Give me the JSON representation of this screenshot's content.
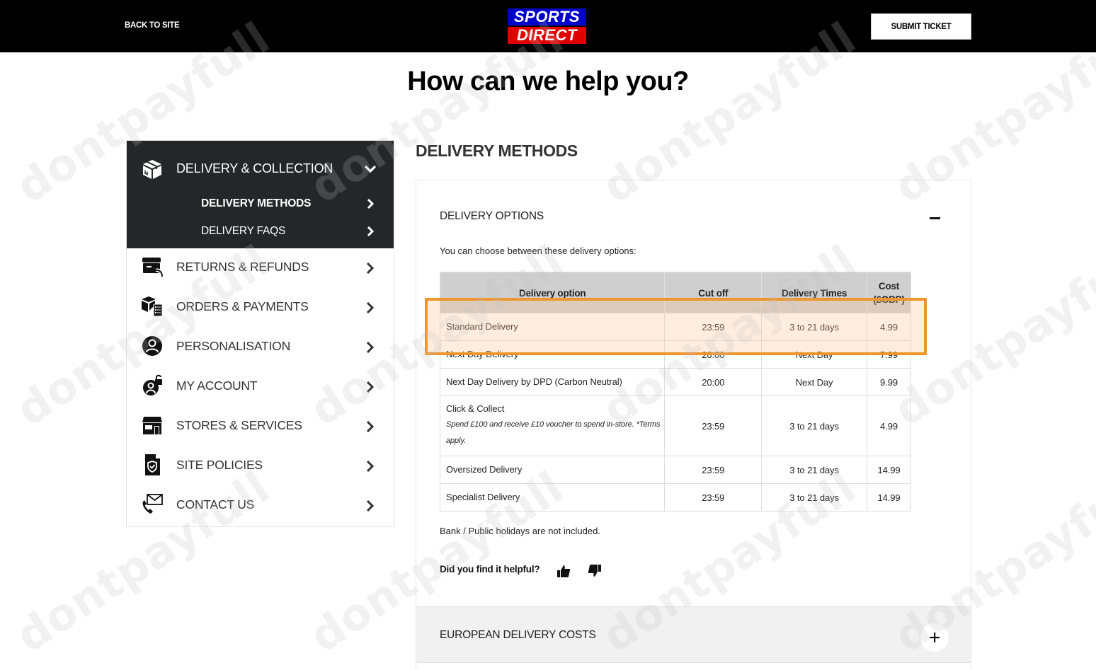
{
  "header": {
    "back_label": "BACK TO SITE",
    "logo_line1": "SPORTS",
    "logo_line2": "DIRECT",
    "submit_label": "SUBMIT TICKET",
    "brand_colors": {
      "blue": "#0000cc",
      "red": "#e00000"
    }
  },
  "page_title": "How can we help you?",
  "sidebar": {
    "active_section": {
      "label": "DELIVERY & COLLECTION",
      "icon": "box-icon",
      "subitems": [
        {
          "label": "DELIVERY METHODS",
          "selected": true
        },
        {
          "label": "DELIVERY FAQS",
          "selected": false
        }
      ]
    },
    "items": [
      {
        "label": "RETURNS & REFUNDS",
        "icon": "return-box-icon"
      },
      {
        "label": "ORDERS & PAYMENTS",
        "icon": "orders-icon"
      },
      {
        "label": "PERSONALISATION",
        "icon": "user-circle-icon"
      },
      {
        "label": "MY ACCOUNT",
        "icon": "account-lock-icon"
      },
      {
        "label": "STORES & SERVICES",
        "icon": "store-icon"
      },
      {
        "label": "SITE POLICIES",
        "icon": "policy-shield-icon"
      },
      {
        "label": "CONTACT US",
        "icon": "contact-icon"
      }
    ]
  },
  "main": {
    "section_title": "DELIVERY METHODS",
    "accordion_open": {
      "title": "DELIVERY OPTIONS",
      "intro": "You can choose between these delivery options:",
      "table": {
        "headers": [
          "Delivery option",
          "Cut off",
          "Delivery Times",
          "Cost (£GBP)"
        ],
        "rows": [
          {
            "option": "Standard Delivery",
            "note": "",
            "cutoff": "23:59",
            "times": "3 to 21 days",
            "cost": "4.99"
          },
          {
            "option": "Next Day Delivery",
            "note": "",
            "cutoff": "20:00",
            "times": "Next Day",
            "cost": "7.99"
          },
          {
            "option": "Next Day Delivery by DPD (Carbon Neutral)",
            "note": "",
            "cutoff": "20:00",
            "times": "Next Day",
            "cost": "9.99"
          },
          {
            "option": "Click & Collect",
            "note": "Spend £100 and receive £10 voucher to spend in-store. *Terms apply.",
            "cutoff": "23:59",
            "times": "3 to 21 days",
            "cost": "4.99"
          },
          {
            "option": "Oversized Delivery",
            "note": "",
            "cutoff": "23:59",
            "times": "3 to 21 days",
            "cost": "14.99"
          },
          {
            "option": "Specialist Delivery",
            "note": "",
            "cutoff": "23:59",
            "times": "3 to 21 days",
            "cost": "14.99"
          }
        ]
      },
      "bank_note": "Bank / Public holidays are not included.",
      "helpful_label": "Did you find it helpful?"
    },
    "accordion_closed": {
      "title": "EUROPEAN DELIVERY COSTS"
    }
  },
  "highlight_color": "#f0952b",
  "watermark": "dontpayfull"
}
